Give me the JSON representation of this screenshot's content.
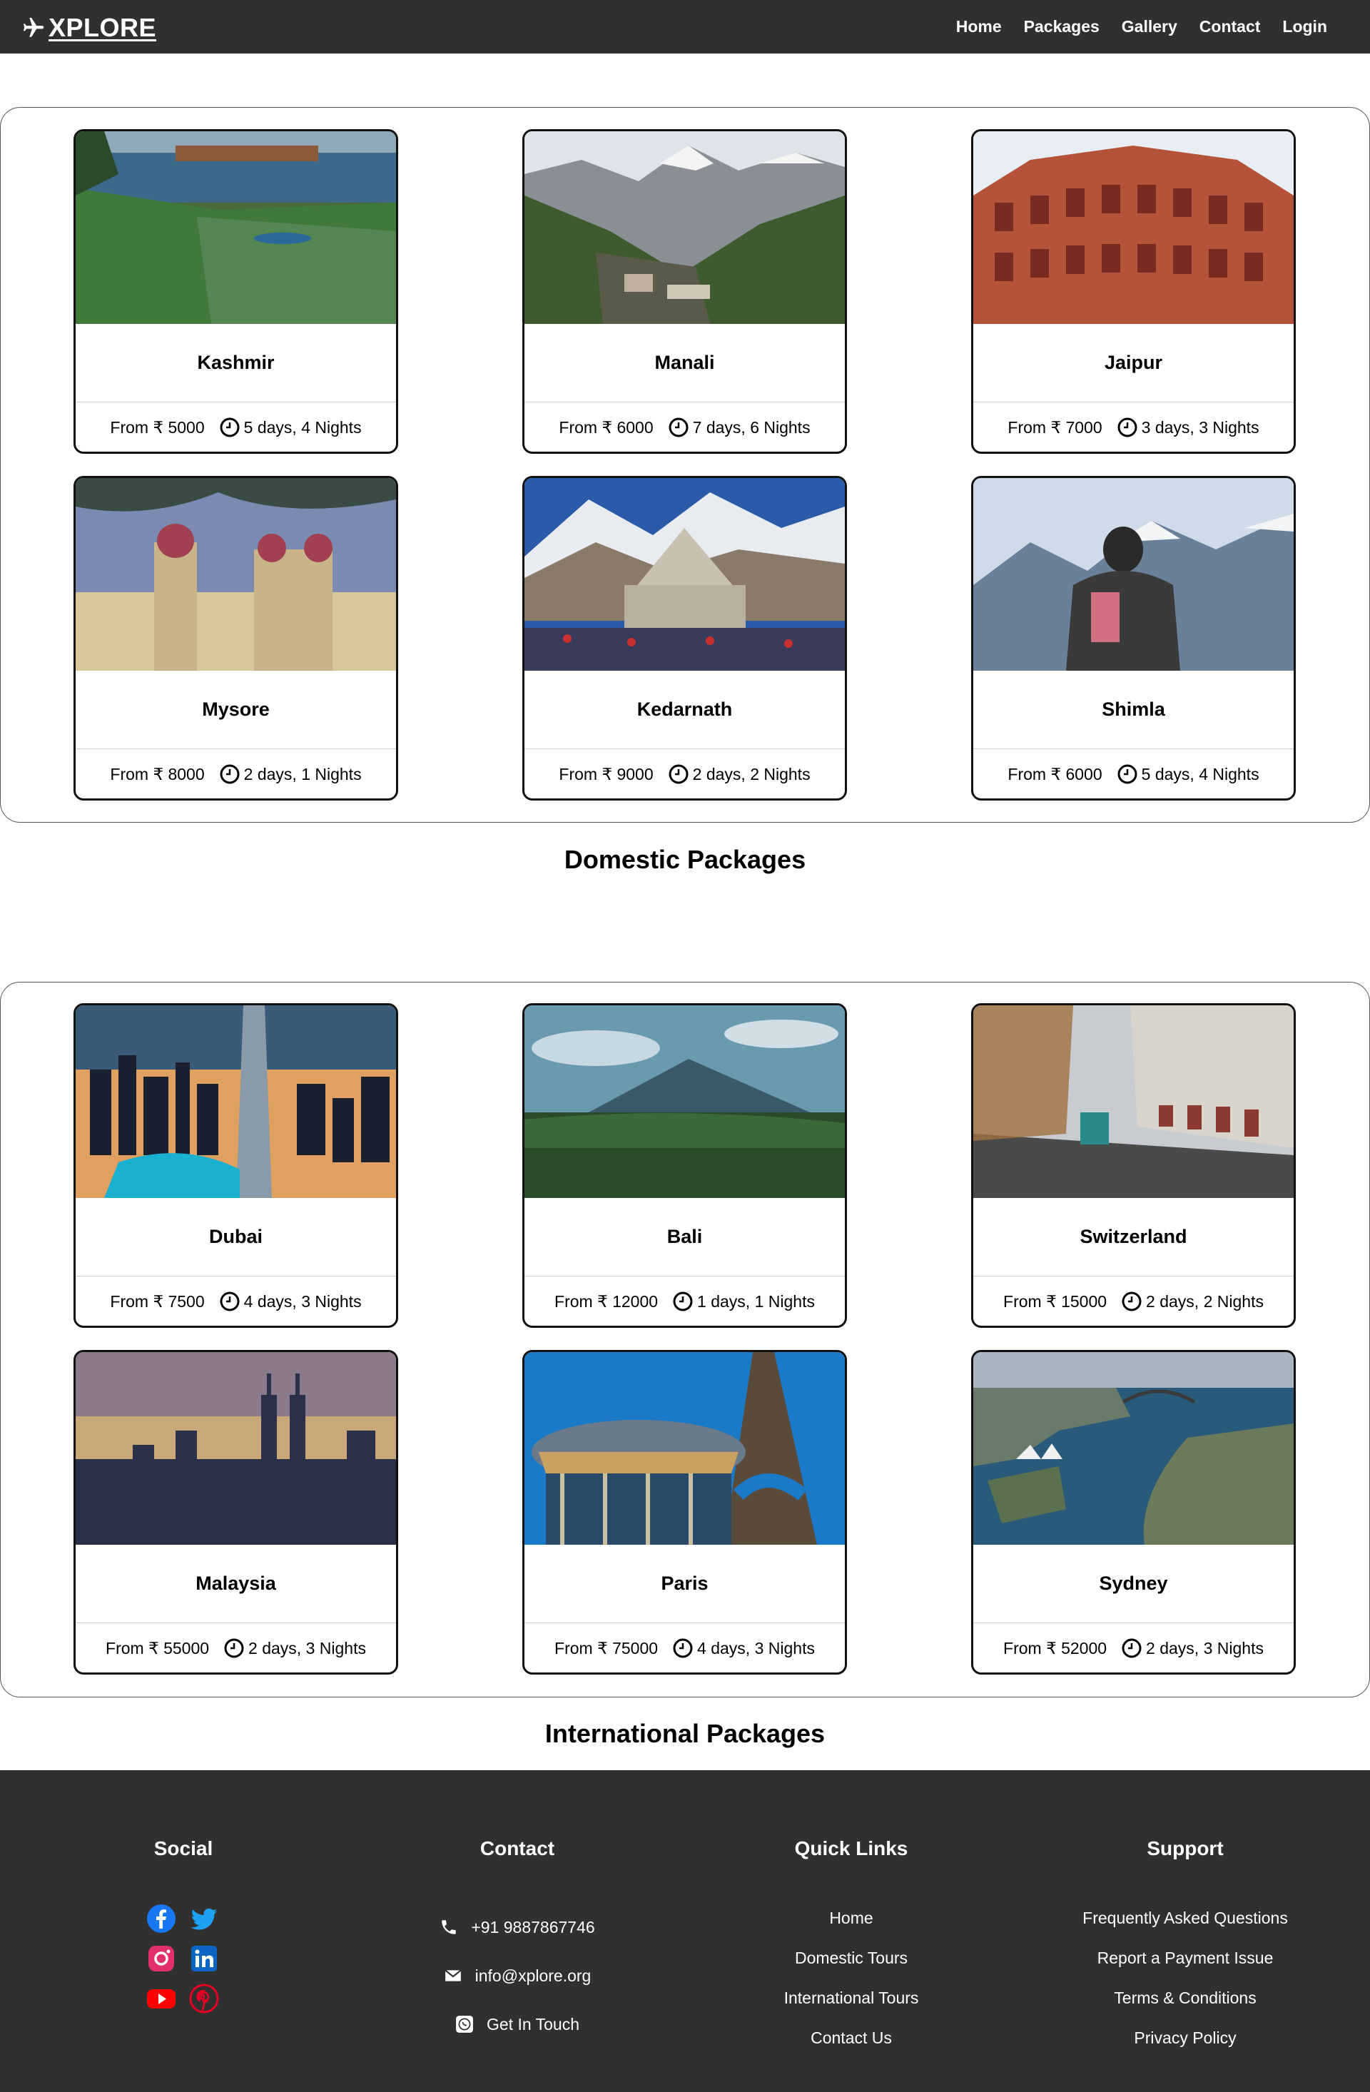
{
  "brand": {
    "name": "XPLORE"
  },
  "nav": {
    "items": [
      "Home",
      "Packages",
      "Gallery",
      "Contact",
      "Login"
    ]
  },
  "domestic": {
    "title": "Domestic Packages",
    "cards": [
      {
        "name": "Kashmir",
        "price": "From ₹ 5000",
        "duration": "5 days, 4 Nights"
      },
      {
        "name": "Manali",
        "price": "From ₹ 6000",
        "duration": "7 days, 6 Nights"
      },
      {
        "name": "Jaipur",
        "price": "From ₹ 7000",
        "duration": "3 days, 3 Nights"
      },
      {
        "name": "Mysore",
        "price": "From ₹ 8000",
        "duration": "2 days, 1 Nights"
      },
      {
        "name": "Kedarnath",
        "price": "From ₹ 9000",
        "duration": "2 days, 2 Nights"
      },
      {
        "name": "Shimla",
        "price": "From ₹ 6000",
        "duration": "5 days, 4 Nights"
      }
    ]
  },
  "international": {
    "title": "International Packages",
    "cards": [
      {
        "name": "Dubai",
        "price": "From ₹ 7500",
        "duration": "4 days, 3 Nights"
      },
      {
        "name": "Bali",
        "price": "From ₹ 12000",
        "duration": "1 days, 1 Nights"
      },
      {
        "name": "Switzerland",
        "price": "From ₹ 15000",
        "duration": "2 days, 2 Nights"
      },
      {
        "name": "Malaysia",
        "price": "From ₹ 55000",
        "duration": "2 days, 3 Nights"
      },
      {
        "name": "Paris",
        "price": "From ₹ 75000",
        "duration": "4 days, 3 Nights"
      },
      {
        "name": "Sydney",
        "price": "From ₹ 52000",
        "duration": "2 days, 3 Nights"
      }
    ]
  },
  "footer": {
    "social": {
      "title": "Social",
      "icons": [
        "facebook-icon",
        "twitter-icon",
        "instagram-icon",
        "linkedin-icon",
        "youtube-icon",
        "pinterest-icon"
      ]
    },
    "contact": {
      "title": "Contact",
      "phone": "+91 9887867746",
      "email": "info@xplore.org",
      "whatsapp": "Get In Touch"
    },
    "quick_links": {
      "title": "Quick Links",
      "items": [
        "Home",
        "Domestic Tours",
        "International Tours",
        "Contact Us"
      ]
    },
    "support": {
      "title": "Support",
      "items": [
        "Frequently Asked Questions",
        "Report a Payment Issue",
        "Terms & Conditions",
        "Privacy Policy"
      ]
    }
  },
  "colors": {
    "navbar": "#303030",
    "footer": "#303030",
    "facebook": "#1877f2",
    "twitter": "#1da1f2",
    "instagram": "#e1306c",
    "linkedin": "#0a66c2",
    "youtube": "#ff0000",
    "pinterest": "#e60023"
  }
}
